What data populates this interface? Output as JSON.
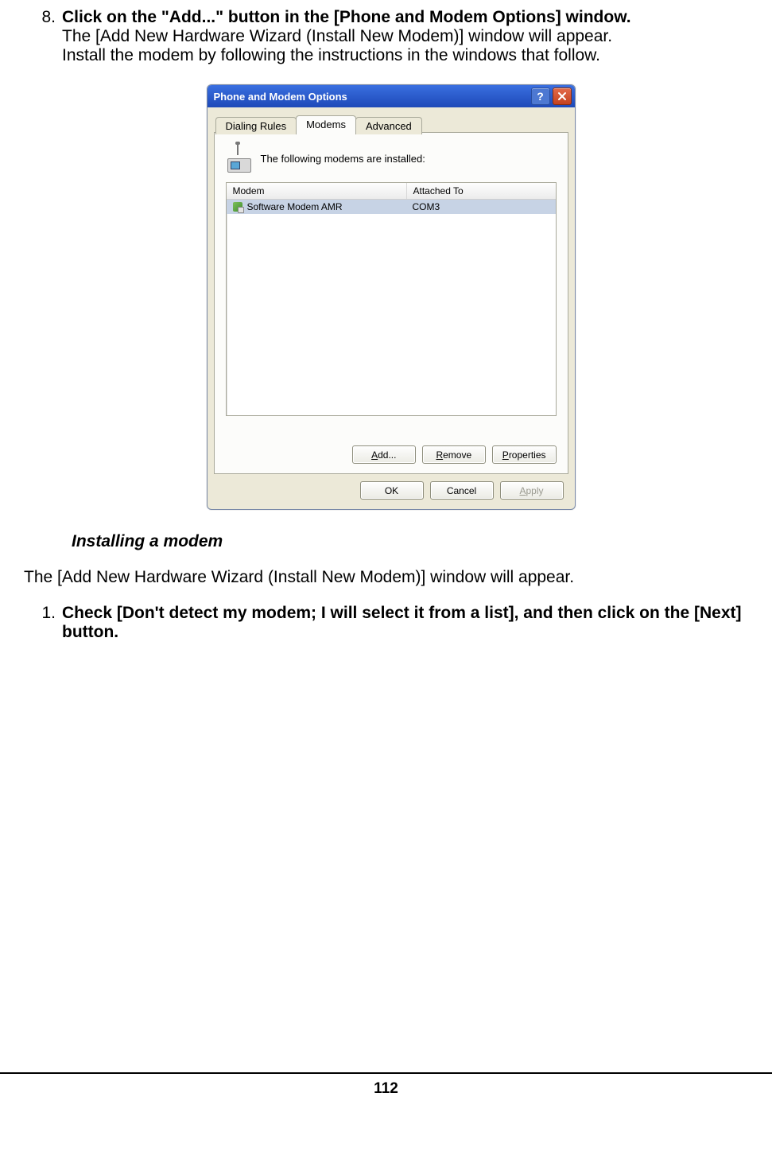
{
  "steps_a": {
    "num": "8.",
    "head": "Click on the \"Add...\" button in the [Phone and Modem Options] window.",
    "line1": "The [Add New Hardware Wizard (Install New Modem)] window will appear.",
    "line2": "Install the modem by following the instructions in the windows that follow."
  },
  "dialog": {
    "title": "Phone and Modem Options",
    "help_char": "?",
    "tabs": {
      "dialing": "Dialing Rules",
      "modems": "Modems",
      "advanced": "Advanced"
    },
    "info": "The following modems are installed:",
    "header": {
      "modem": "Modem",
      "attached": "Attached To"
    },
    "row": {
      "name": "Software Modem AMR",
      "port": "COM3"
    },
    "buttons": {
      "add_pref": "A",
      "add_rest": "dd...",
      "remove_r": "R",
      "remove_rest": "emove",
      "prop_p": "P",
      "prop_rest": "roperties",
      "ok": "OK",
      "cancel": "Cancel",
      "apply_a": "A",
      "apply_rest": "pply"
    }
  },
  "subheading": "Installing a modem",
  "para": "The [Add New Hardware Wizard (Install New Modem)] window will appear.",
  "steps_b": {
    "num": "1.",
    "body": "Check [Don't detect my modem; I will select it from a list], and then click on the [Next] button."
  },
  "page_number": "112"
}
